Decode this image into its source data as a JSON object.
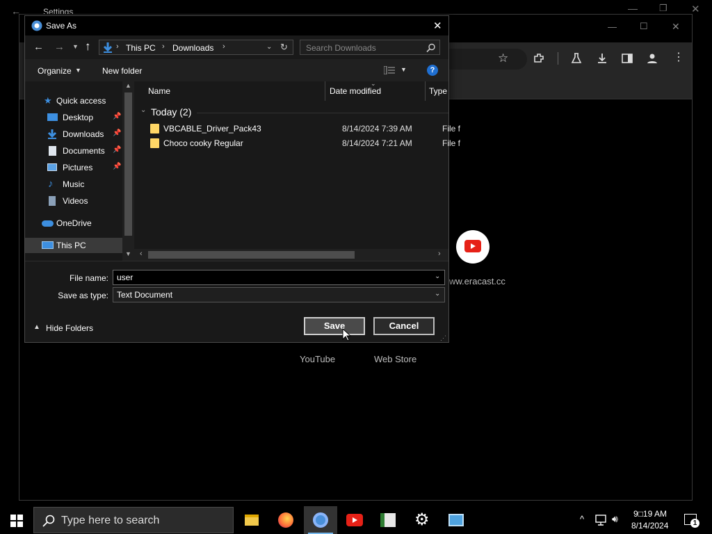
{
  "settings_window": {
    "title": "Settings"
  },
  "chrome": {
    "shortcuts": [
      {
        "label": "YouTube"
      },
      {
        "label": "Web Store"
      }
    ],
    "partial_site_url": "ww.eracast.cc"
  },
  "dialog": {
    "title": "Save As",
    "breadcrumb": [
      "This PC",
      "Downloads"
    ],
    "search_placeholder": "Search Downloads",
    "commands": {
      "organize": "Organize",
      "new_folder": "New folder"
    },
    "nav_items": [
      {
        "label": "Quick access",
        "icon": "star-icon"
      },
      {
        "label": "Desktop",
        "icon": "desktop-icon",
        "pinned": true
      },
      {
        "label": "Downloads",
        "icon": "download-icon",
        "pinned": true
      },
      {
        "label": "Documents",
        "icon": "document-icon",
        "pinned": true
      },
      {
        "label": "Pictures",
        "icon": "pictures-icon",
        "pinned": true
      },
      {
        "label": "Music",
        "icon": "music-icon"
      },
      {
        "label": "Videos",
        "icon": "video-icon"
      },
      {
        "label": "OneDrive",
        "icon": "cloud-icon"
      },
      {
        "label": "This PC",
        "icon": "computer-icon",
        "selected": true
      }
    ],
    "columns": {
      "name": "Name",
      "date_modified": "Date modified",
      "type": "Type"
    },
    "group_label": "Today (2)",
    "files": [
      {
        "name": "VBCABLE_Driver_Pack43",
        "date": "8/14/2024 7:39 AM",
        "type": "File f"
      },
      {
        "name": "Choco cooky Regular",
        "date": "8/14/2024 7:21 AM",
        "type": "File f"
      }
    ],
    "file_name_label": "File name:",
    "file_name_value": "user",
    "save_type_label": "Save as type:",
    "save_type_value": "Text Document",
    "hide_folders": "Hide Folders",
    "save_button": "Save",
    "cancel_button": "Cancel"
  },
  "taskbar": {
    "search_placeholder": "Type here to search",
    "apps": [
      "file-explorer-icon",
      "firefox-icon",
      "chrome-icon",
      "youtube-icon",
      "app-icon",
      "settings-gear-icon",
      "control-panel-icon"
    ],
    "clock_time": "9□19 AM",
    "clock_date": "8/14/2024",
    "notification_count": "1"
  }
}
